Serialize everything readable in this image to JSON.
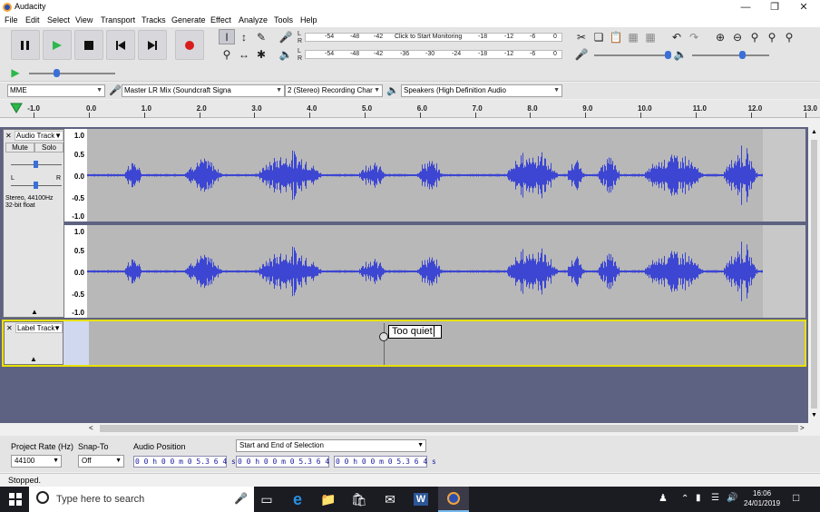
{
  "window": {
    "title": "Audacity"
  },
  "menu": [
    "File",
    "Edit",
    "Select",
    "View",
    "Transport",
    "Tracks",
    "Generate",
    "Effect",
    "Analyze",
    "Tools",
    "Help"
  ],
  "meters": {
    "record_scale": [
      "-54",
      "-48",
      "-42",
      "Click to Start Monitoring",
      "-18",
      "-12",
      "-6",
      "0"
    ],
    "play_scale": [
      "-54",
      "-48",
      "-42",
      "-36",
      "-30",
      "-24",
      "-18",
      "-12",
      "-6",
      "0"
    ],
    "lr": [
      "L",
      "R"
    ]
  },
  "device": {
    "host": "MME",
    "input": "Master LR Mix (Soundcraft Signa",
    "channels": "2 (Stereo) Recording Char",
    "output": "Speakers (High Definition Audio"
  },
  "ruler": [
    "-1.0",
    "0.0",
    "1.0",
    "2.0",
    "3.0",
    "4.0",
    "5.0",
    "6.0",
    "7.0",
    "8.0",
    "9.0",
    "10.0",
    "11.0",
    "12.0",
    "13.0"
  ],
  "audio_track": {
    "name": "Audio Track",
    "mute": "Mute",
    "solo": "Solo",
    "gain_l": "L",
    "gain_r": "R",
    "info": "Stereo, 44100Hz",
    "format": "32-bit float",
    "scale": [
      "1.0",
      "0.5",
      "0.0",
      "-0.5",
      "-1.0"
    ]
  },
  "label_track": {
    "name": "Label Track",
    "label_text": "Too quiet"
  },
  "selection_bar": {
    "rate_label": "Project Rate (Hz)",
    "rate_value": "44100",
    "snap_label": "Snap-To",
    "snap_value": "Off",
    "audio_pos_label": "Audio Position",
    "audio_pos": "0 0 h 0 0 m 0 5.3 6 4 s",
    "sel_mode": "Start and End of Selection",
    "sel_start": "0 0 h 0 0 m 0 5.3 6 4 s",
    "sel_end": "0 0 h 0 0 m 0 5.3 6 4 s"
  },
  "status": "Stopped.",
  "taskbar": {
    "search_placeholder": "Type here to search",
    "time": "16:06",
    "date": "24/01/2019"
  },
  "colors": {
    "waveform": "#3c46d2",
    "track_bg": "#b8b8b8",
    "label_border": "#e8e000",
    "track_area": "#5e6282"
  }
}
